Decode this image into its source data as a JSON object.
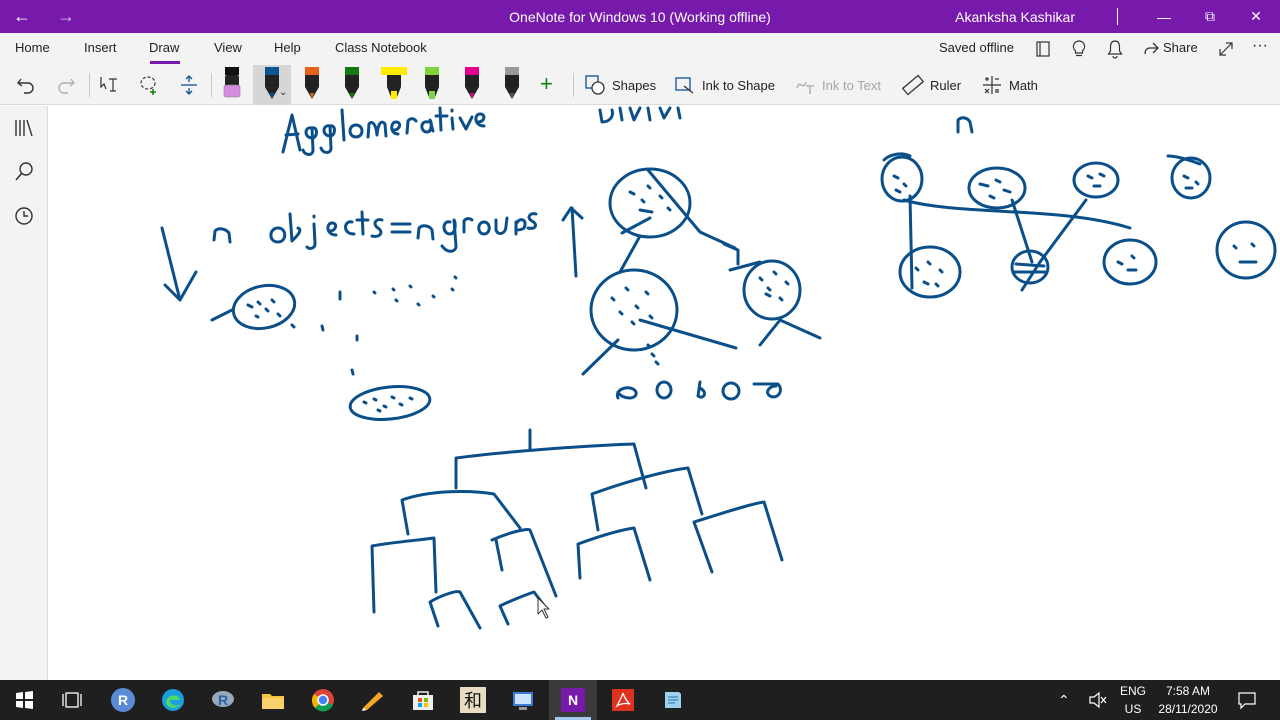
{
  "titlebar": {
    "title": "OneNote for Windows 10 (Working offline)",
    "user": "Akanksha Kashikar",
    "back_icon": "←",
    "forward_icon": "→",
    "minimize": "—",
    "restore": "⧉",
    "close": "✕",
    "color": "#7719aa"
  },
  "ribbon": {
    "tabs": [
      "Home",
      "Insert",
      "Draw",
      "View",
      "Help",
      "Class Notebook"
    ],
    "active_tab": "Draw",
    "status": "Saved offline",
    "share_label": "Share",
    "more": "···"
  },
  "toolbar": {
    "shapes_label": "Shapes",
    "ink_to_shape_label": "Ink to Shape",
    "ink_to_text_label": "Ink to Text",
    "ruler_label": "Ruler",
    "math_label": "Math",
    "add_pen": "+",
    "pens": [
      {
        "name": "pen-black",
        "color": "#111111"
      },
      {
        "name": "pen-blue-selected",
        "color": "#0b5394"
      },
      {
        "name": "pen-orange",
        "color": "#e8601c"
      },
      {
        "name": "pen-green",
        "color": "#107c10"
      },
      {
        "name": "highlighter-yellow",
        "color": "#ffeb00"
      },
      {
        "name": "highlighter-green",
        "color": "#7fd43a"
      },
      {
        "name": "pen-red",
        "color": "#e3008c"
      },
      {
        "name": "pen-gray",
        "color": "#555555"
      }
    ],
    "highlighter_pink": "#d68ae0"
  },
  "ink": {
    "color": "#0b4f8a"
  },
  "taskbar": {
    "lang_top": "ENG",
    "lang_bottom": "US",
    "time": "7:58 AM",
    "date": "28/11/2020",
    "r_label": "R",
    "kanji": "和",
    "onenote_letter": "N"
  }
}
